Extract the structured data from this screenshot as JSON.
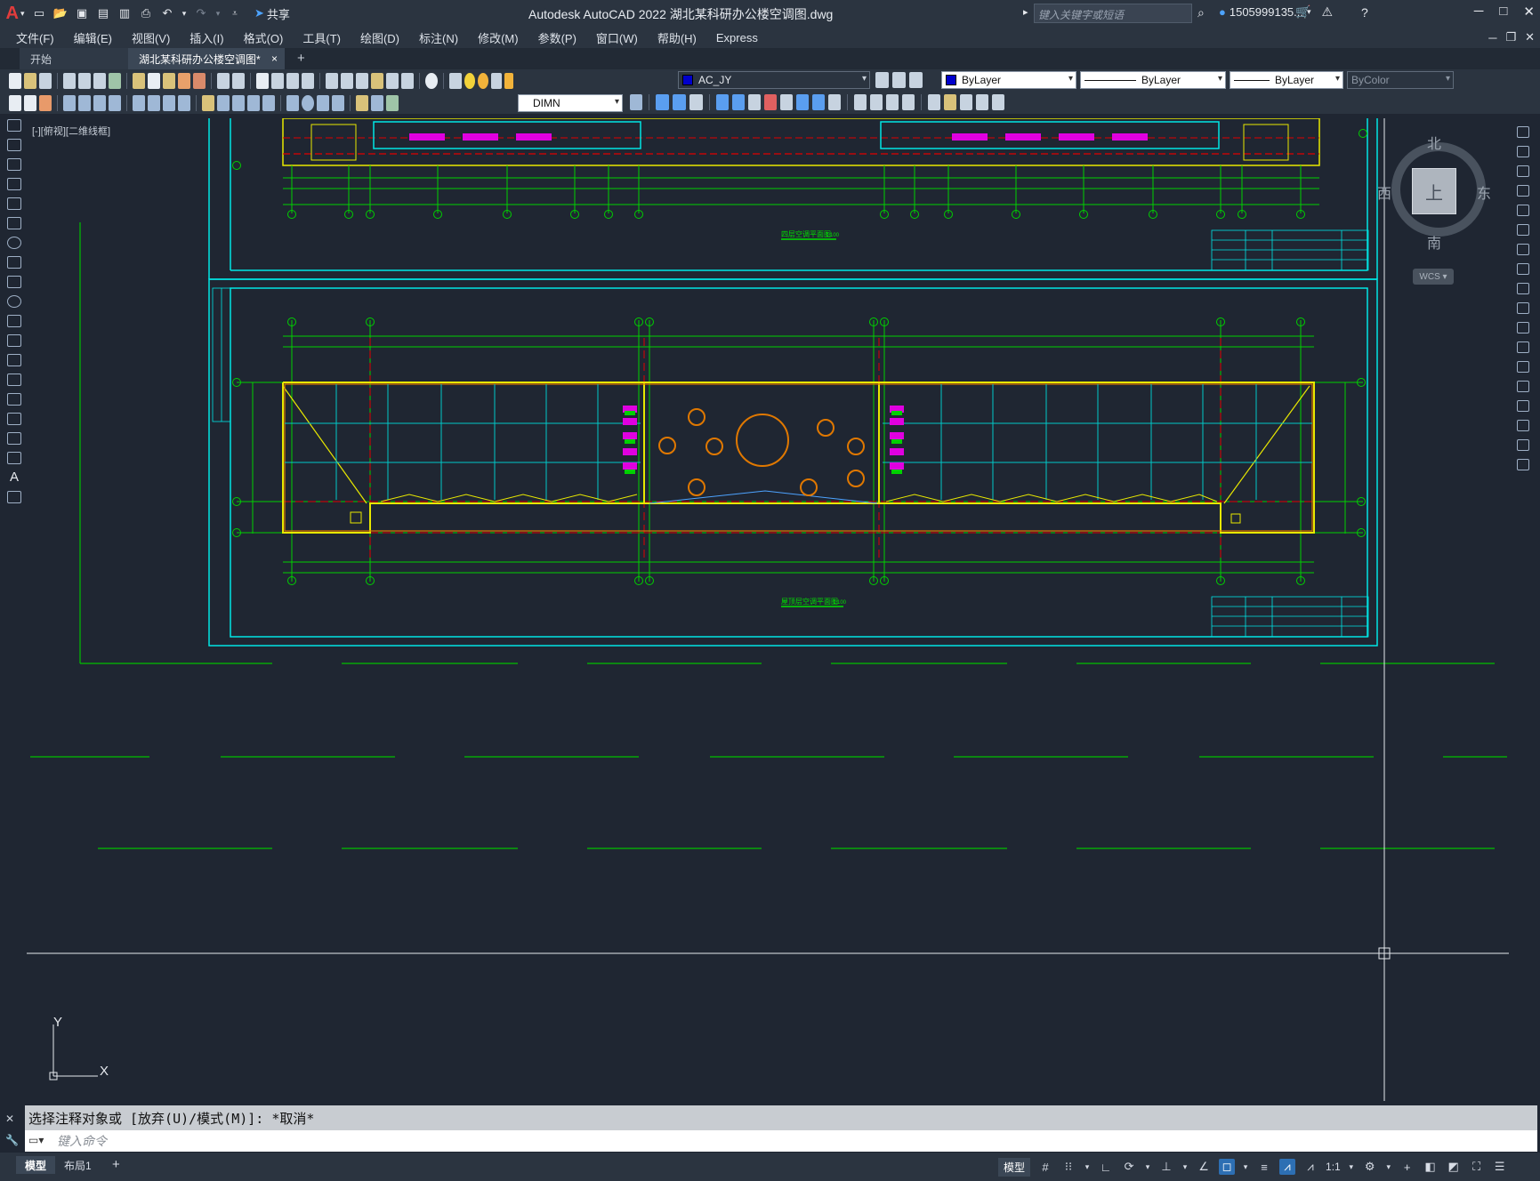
{
  "titlebar": {
    "logo": "A",
    "title": "Autodesk AutoCAD 2022    湖北某科研办公楼空调图.dwg",
    "share_label": "共享",
    "search_placeholder": "键入关键字或短语",
    "user_name": "1505999135...",
    "icons": [
      "new-icon",
      "open-icon",
      "save-icon",
      "saveas-icon",
      "plot-icon",
      "print-icon",
      "undo-icon",
      "redo-icon",
      "share-icon",
      "search-icon",
      "user-icon",
      "cart-icon",
      "help-icon"
    ]
  },
  "menubar": {
    "items": [
      "文件(F)",
      "编辑(E)",
      "视图(V)",
      "插入(I)",
      "格式(O)",
      "工具(T)",
      "绘图(D)",
      "标注(N)",
      "修改(M)",
      "参数(P)",
      "窗口(W)",
      "帮助(H)",
      "Express"
    ]
  },
  "tabs": {
    "start": "开始",
    "active": "湖北某科研办公楼空调图*",
    "close": "×",
    "add": "+"
  },
  "toolbar": {
    "layer_name": "AC_JY",
    "color_value": "ByLayer",
    "linetype_value": "ByLayer",
    "lineweight_value": "ByLayer",
    "plotstyle_value": "ByColor",
    "dimstyle_value": "DIMN",
    "layer_color": "#0000cc"
  },
  "viewport": {
    "label": "[-][俯视][二维线框]"
  },
  "viewcube": {
    "north": "北",
    "south": "南",
    "east": "东",
    "west": "西",
    "face": "上",
    "wcs_label": "WCS"
  },
  "drawing": {
    "title_upper": "四层空调平面图",
    "title_upper_scale": "1:100",
    "title_lower": "屋顶层空调平面图",
    "title_lower_scale": "1:100",
    "ucs_x": "X",
    "ucs_y": "Y"
  },
  "commandline": {
    "history": "选择注释对象或 [放弃(U)/模式(M)]: *取消*",
    "input_placeholder": "键入命令"
  },
  "statusbar": {
    "layout_model": "模型",
    "layout_1": "布局1",
    "layout_add": "+",
    "model_button": "模型",
    "scale": "1:1"
  },
  "colors": {
    "background": "#1f2632",
    "cyan_frame": "#00e5e5",
    "green_lines": "#00d000",
    "yellow_walls": "#e8e800",
    "red_axis": "#e00000",
    "orange_ducts": "#e07800",
    "magenta_units": "#e000e0"
  }
}
